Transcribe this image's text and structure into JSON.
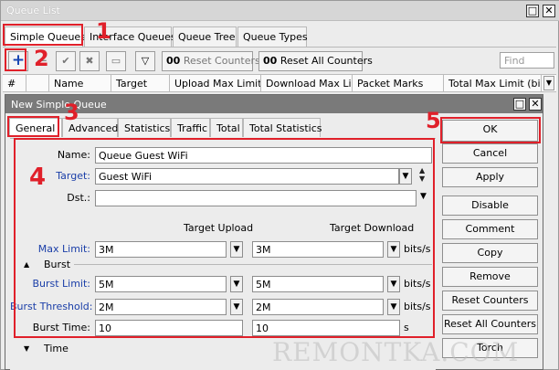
{
  "outer": {
    "title": "Queue List",
    "tabs": [
      "Simple Queues",
      "Interface Queues",
      "Queue Tree",
      "Queue Types"
    ],
    "toolbar": {
      "reset_counters": "Reset Counters",
      "reset_all_counters": "Reset All Counters",
      "counter_prefix": "00",
      "find_placeholder": "Find"
    },
    "columns": [
      "#",
      "Name",
      "Target",
      "Upload Max Limit",
      "Download Max Limit",
      "Packet Marks",
      "Total Max Limit (bi..."
    ]
  },
  "dialog": {
    "title": "New Simple Queue",
    "tabs": [
      "General",
      "Advanced",
      "Statistics",
      "Traffic",
      "Total",
      "Total Statistics"
    ],
    "form": {
      "name_label": "Name:",
      "name_value": "Queue Guest WiFi",
      "target_label": "Target:",
      "target_value": "Guest WiFi",
      "dst_label": "Dst.:",
      "dst_value": "",
      "target_upload_hdr": "Target Upload",
      "target_download_hdr": "Target Download",
      "max_limit_label": "Max Limit:",
      "max_limit_up": "3M",
      "max_limit_down": "3M",
      "burst_section": "Burst",
      "burst_limit_label": "Burst Limit:",
      "burst_limit_up": "5M",
      "burst_limit_down": "5M",
      "burst_threshold_label": "Burst Threshold:",
      "burst_threshold_up": "2M",
      "burst_threshold_down": "2M",
      "burst_time_label": "Burst Time:",
      "burst_time_up": "10",
      "burst_time_down": "10",
      "unit_bits": "bits/s",
      "unit_s": "s",
      "time_section": "Time"
    },
    "buttons": [
      "OK",
      "Cancel",
      "Apply",
      "Disable",
      "Comment",
      "Copy",
      "Remove",
      "Reset Counters",
      "Reset All Counters",
      "Torch"
    ]
  },
  "annotations": [
    "1",
    "2",
    "3",
    "4",
    "5"
  ],
  "watermark": "REMONTKA.COM",
  "colors": {
    "annotation_red": "#e0202a",
    "label_blue": "#1a3ea8",
    "dialog_title_bg": "#7a7a7a"
  }
}
